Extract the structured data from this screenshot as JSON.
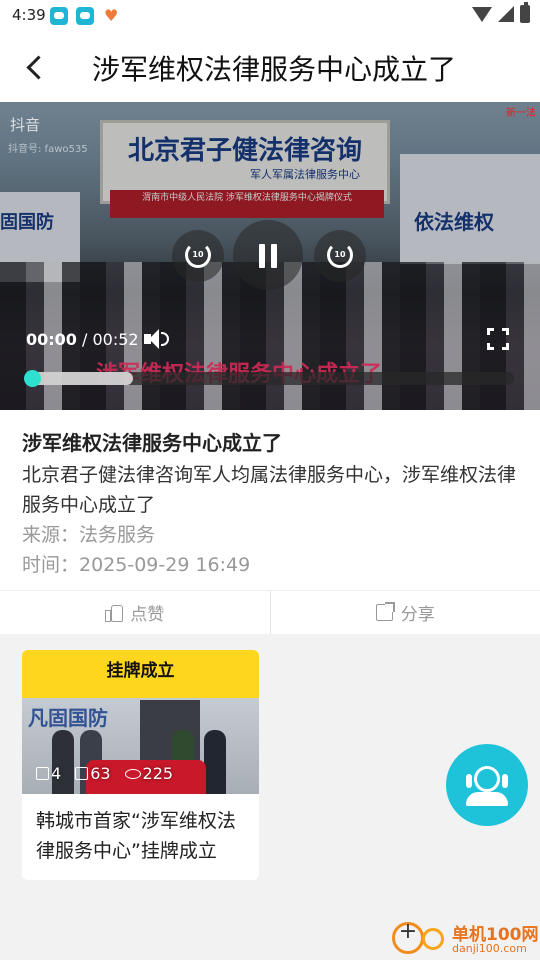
{
  "status_bar": {
    "time": "4:39"
  },
  "header": {
    "title": "涉军维权法律服务中心成立了"
  },
  "video": {
    "watermark": "抖音",
    "watermark_id": "抖音号: fawo535",
    "corner_text": "新一法",
    "sign_main": "北京君子健法律咨询",
    "sign_sub": "军人军属法律服务中心",
    "banner_text": "渭南市中级人民法院 涉军维权法律服务中心揭牌仪式",
    "left_panel_text": "固国防",
    "right_panel_text": "依法维权",
    "rewind_label": "10",
    "forward_label": "10",
    "current_time": "00:00",
    "separator": " / ",
    "duration": "00:52",
    "subtitle": "涉军维权法律服务中心成立了",
    "progress_fraction": 0,
    "buffered_fraction": 0.22
  },
  "article": {
    "title": "涉军维权法律服务中心成立了",
    "summary": "北京君子健法律咨询军人均属法律服务中心，涉军维权法律服务中心成立了",
    "source": "来源：法务服务",
    "time": "时间：2025-09-29 16:49"
  },
  "actions": {
    "like_label": "点赞",
    "share_label": "分享"
  },
  "related": [
    {
      "thumb_banner": "挂牌成立",
      "thumb_wall_text": "凡固国防",
      "likes": "4",
      "shares": "63",
      "views": "225",
      "title": "韩城市首家“涉军维权法律服务中心”挂牌成立"
    }
  ],
  "brand": {
    "name": "单机100网",
    "url": "danji100.com"
  },
  "colors": {
    "accent": "#1fc3d9",
    "progress_knob": "#2ee0d0",
    "brand": "#e8731c"
  }
}
